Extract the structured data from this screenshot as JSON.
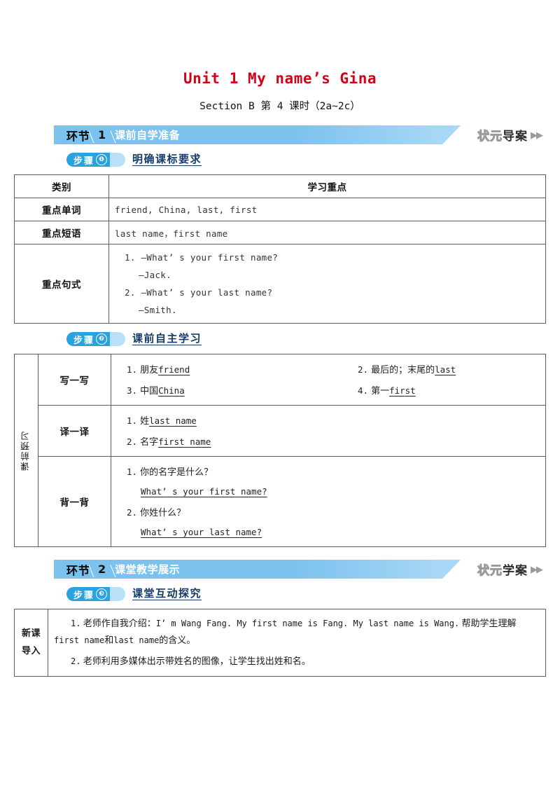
{
  "document": {
    "title": "Unit 1 My name’s Gina",
    "subtitle": "Section B  第 4 课时（2a~2c）"
  },
  "sections": [
    {
      "banner": {
        "phase_label": "环节",
        "number": "1",
        "text": "课前自学准备",
        "right_outline": "状元",
        "right_solid": "导案",
        "right_arrow": "▶▶"
      },
      "step": {
        "pill_label": "步骤",
        "pill_number": "❶",
        "title": "明确课标要求"
      }
    },
    {
      "banner": {
        "phase_label": "环节",
        "number": "2",
        "text": "课堂教学展示",
        "right_outline": "状元",
        "right_solid": "学案",
        "right_arrow": "▶▶"
      },
      "step": {
        "pill_label": "步骤",
        "pill_number": "❸",
        "title": "课堂互动探究"
      }
    }
  ],
  "step2": {
    "pill_label": "步骤",
    "pill_number": "❷",
    "title": "课前自主学习"
  },
  "table_goals": {
    "headers": [
      "类别",
      "学习重点"
    ],
    "rows": [
      {
        "label": "重点单词",
        "content": "friend, China, last, first"
      },
      {
        "label": "重点短语",
        "content": "last name，first name"
      }
    ],
    "sentences_label": "重点句式",
    "sentences": [
      "1.  —What’ s your first name?",
      "—Jack.",
      "2.  —What’ s your last name?",
      "—Smith."
    ]
  },
  "table_preview": {
    "side_label": "课前预习",
    "rows": [
      {
        "label": "写一写",
        "lines": [
          [
            {
              "num": "1.",
              "cn": "朋友",
              "answer": "friend"
            },
            {
              "num": "2.",
              "cn": "最后的；末尾的",
              "answer": "last"
            }
          ],
          [
            {
              "num": "3.",
              "cn": "中国",
              "answer": "China"
            },
            {
              "num": "4.",
              "cn": "第一",
              "answer": "first"
            }
          ]
        ]
      },
      {
        "label": "译一译",
        "lines": [
          [
            {
              "num": "1.",
              "cn": "姓",
              "answer": "last name"
            }
          ],
          [
            {
              "num": "2.",
              "cn": "名字",
              "answer": "first name"
            }
          ]
        ]
      }
    ],
    "recite": {
      "label": "背一背",
      "items": [
        {
          "num": "1.",
          "question": "你的名字是什么？",
          "answer": "What’ s your first name?"
        },
        {
          "num": "2.",
          "question": "你姓什么？",
          "answer": "What’ s your last name?"
        }
      ]
    }
  },
  "table_lesson": {
    "side_label": "新课导入",
    "paragraphs": [
      {
        "num": "1.",
        "part_zh_1": "老师作自我介绍：",
        "part_en_1": "I’ m Wang Fang. My first name is Fang. My last name is Wang.",
        "part_zh_2": "帮助学生理解",
        "part_en_2": "first name",
        "part_zh_3": "和",
        "part_en_3": "last name",
        "part_zh_4": "的含义。"
      },
      {
        "num": "2.",
        "part_zh_1": "老师利用多媒体出示带姓名的图像，让学生找出姓和名。"
      }
    ]
  },
  "colors": {
    "title_red": "#d80019",
    "banner_blue": "#7cc2ef",
    "banner_blue_light": "#a8d8f5",
    "pill_blue": "#29a3dd",
    "pill_tail": "#b9e0f6",
    "step_title": "#153a68"
  }
}
